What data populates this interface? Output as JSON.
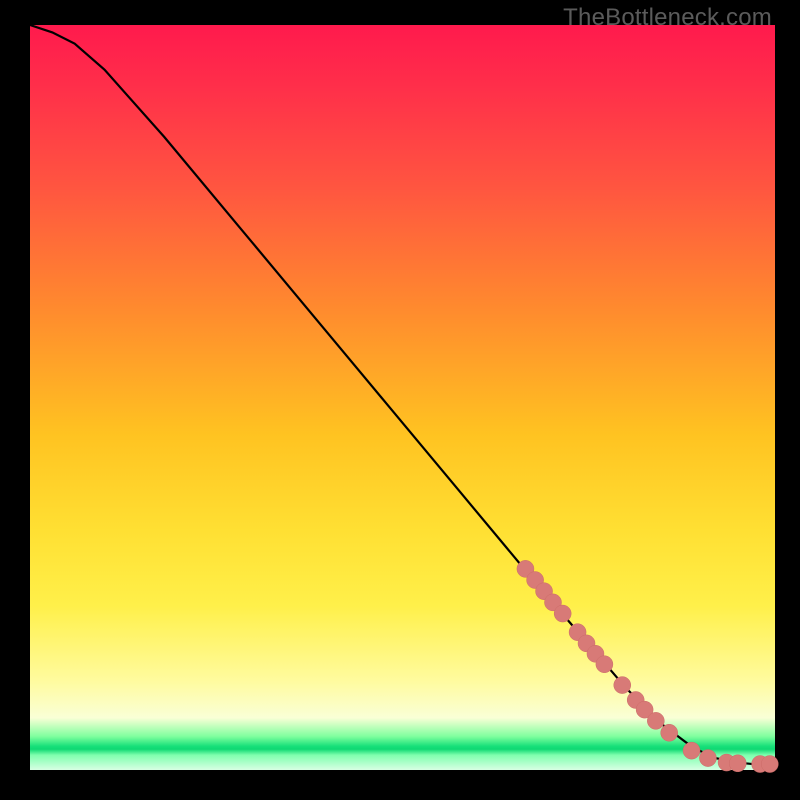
{
  "watermark": "TheBottleneck.com",
  "colors": {
    "frame_bg": "#000000",
    "curve": "#000000",
    "marker_fill": "#d87a77",
    "marker_stroke": "#cc6c68"
  },
  "chart_data": {
    "type": "line",
    "title": "",
    "xlabel": "",
    "ylabel": "",
    "xlim": [
      0,
      100
    ],
    "ylim": [
      0,
      100
    ],
    "curve": {
      "x": [
        0,
        3,
        6,
        10,
        18,
        28,
        38,
        48,
        58,
        68,
        74,
        80,
        85,
        89,
        92,
        95,
        97,
        99,
        100
      ],
      "y": [
        100,
        99,
        97.5,
        94,
        85,
        73,
        61,
        49,
        37,
        25,
        18,
        11,
        6,
        3,
        1.6,
        1.0,
        0.8,
        0.8,
        0.8
      ]
    },
    "series": [
      {
        "name": "markers",
        "points": [
          {
            "x": 66.5,
            "y": 27.0
          },
          {
            "x": 67.8,
            "y": 25.5
          },
          {
            "x": 69.0,
            "y": 24.0
          },
          {
            "x": 70.2,
            "y": 22.5
          },
          {
            "x": 71.5,
            "y": 21.0
          },
          {
            "x": 73.5,
            "y": 18.5
          },
          {
            "x": 74.7,
            "y": 17.0
          },
          {
            "x": 75.9,
            "y": 15.6
          },
          {
            "x": 77.1,
            "y": 14.2
          },
          {
            "x": 79.5,
            "y": 11.4
          },
          {
            "x": 81.3,
            "y": 9.4
          },
          {
            "x": 82.5,
            "y": 8.1
          },
          {
            "x": 84.0,
            "y": 6.6
          },
          {
            "x": 85.8,
            "y": 5.0
          },
          {
            "x": 88.8,
            "y": 2.6
          },
          {
            "x": 91.0,
            "y": 1.6
          },
          {
            "x": 93.5,
            "y": 1.0
          },
          {
            "x": 95.0,
            "y": 0.9
          },
          {
            "x": 98.0,
            "y": 0.8
          },
          {
            "x": 99.3,
            "y": 0.8
          }
        ]
      }
    ]
  }
}
